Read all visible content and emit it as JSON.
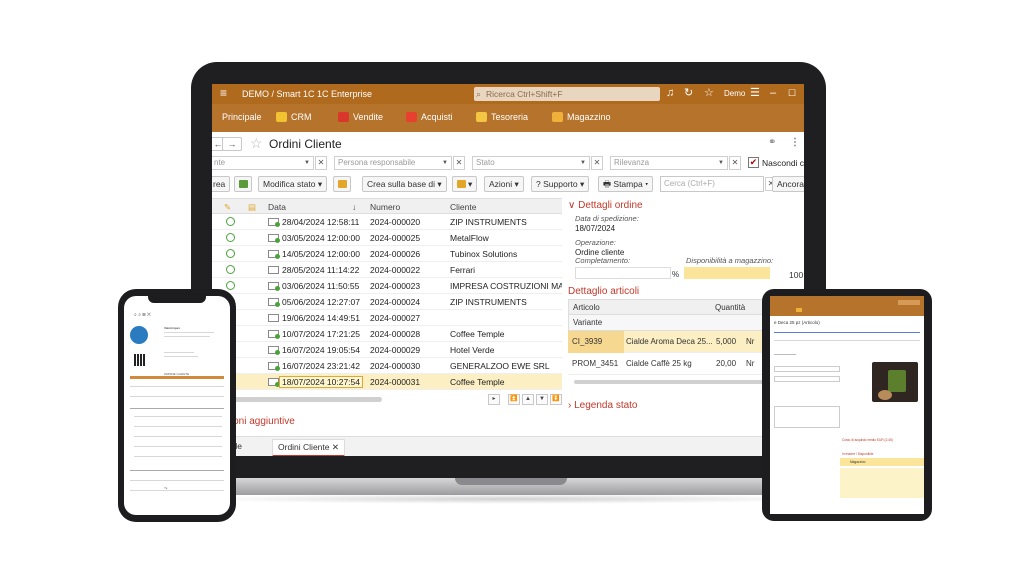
{
  "app": {
    "title": "DEMO / Smart 1C 1C Enterprise",
    "search_placeholder": "Ricerca Ctrl+Shift+F",
    "user": "Demo"
  },
  "sections": [
    "Principale",
    "CRM",
    "Vendite",
    "Acquisti",
    "Tesoreria",
    "Magazzino"
  ],
  "page": {
    "title": "Ordini Cliente",
    "back": "←",
    "forward": "→"
  },
  "filters": {
    "partial_left": "nte",
    "persona": "Persona responsabile",
    "stato": "Stato",
    "rilevanza": "Rilevanza",
    "nascondi": "Nascondi ch"
  },
  "commands": {
    "crea": "rea",
    "modifica_stato": "Modifica stato",
    "crea_sulla_base": "Crea sulla base di",
    "azioni": "Azioni",
    "supporto": "Supporto",
    "stampa": "Stampa",
    "search_placeholder": "Cerca (Ctrl+F)",
    "ancora": "Ancora"
  },
  "grid": {
    "columns": [
      "Data",
      "Numero",
      "Cliente"
    ],
    "rows": [
      {
        "date": "28/04/2024 12:58:11",
        "number": "2024-000020",
        "client": "ZIP INSTRUMENTS"
      },
      {
        "date": "03/05/2024 12:00:00",
        "number": "2024-000025",
        "client": "MetalFlow"
      },
      {
        "date": "14/05/2024 12:00:00",
        "number": "2024-000026",
        "client": "Tubinox Solutions"
      },
      {
        "date": "28/05/2024 11:14:22",
        "number": "2024-000022",
        "client": "Ferrari"
      },
      {
        "date": "03/06/2024 11:50:55",
        "number": "2024-000023",
        "client": "IMPRESA COSTRUZIONI MARI &"
      },
      {
        "date": "05/06/2024 12:27:07",
        "number": "2024-000024",
        "client": "ZIP INSTRUMENTS"
      },
      {
        "date": "19/06/2024 14:49:51",
        "number": "2024-000027",
        "client": ""
      },
      {
        "date": "10/07/2024 17:21:25",
        "number": "2024-000028",
        "client": "Coffee Temple"
      },
      {
        "date": "16/07/2024 19:05:54",
        "number": "2024-000029",
        "client": "Hotel Verde"
      },
      {
        "date": "16/07/2024 23:21:42",
        "number": "2024-000030",
        "client": "GENERALZOO EWE SRL"
      },
      {
        "date": "18/07/2024 10:27:54",
        "number": "2024-000031",
        "client": "Coffee Temple"
      }
    ]
  },
  "more_info": "mazioni aggiuntive",
  "tabs": {
    "iniziale": "iniziale",
    "ordini": "Ordini Cliente"
  },
  "details": {
    "title": "Dettagli ordine",
    "ship_label": "Data di spedizione:",
    "ship_value": "18/07/2024",
    "op_label": "Operazione:",
    "op_value": "Ordine cliente",
    "completion_label": "Completamento:",
    "pct": "%",
    "avail_label": "Disponibilità a magazzino:",
    "avail_value": "100"
  },
  "articles": {
    "title": "Dettaglio articoli",
    "col_articolo": "Articolo",
    "col_quantita": "Quantità",
    "col_variante": "Variante",
    "rows": [
      {
        "code": "CI_3939",
        "name": "Cialde Aroma Deca 25...",
        "qty": "5,000",
        "unit": "Nr"
      },
      {
        "code": "PROM_3451",
        "name": "Cialde Caffè 25 kg",
        "qty": "20,00",
        "unit": "Nr"
      }
    ]
  },
  "legend": "Legenda stato",
  "phone": {
    "company": "Valorimpex",
    "section": "ORDINE CLIENTE"
  },
  "tablet": {
    "product": "e Deca 25 pz (Articolo)",
    "price_text": "Costo di acquisto medio EUR (2.45)",
    "stock_label": "In essere / Disponibile",
    "warehouse": "Magazzino"
  }
}
